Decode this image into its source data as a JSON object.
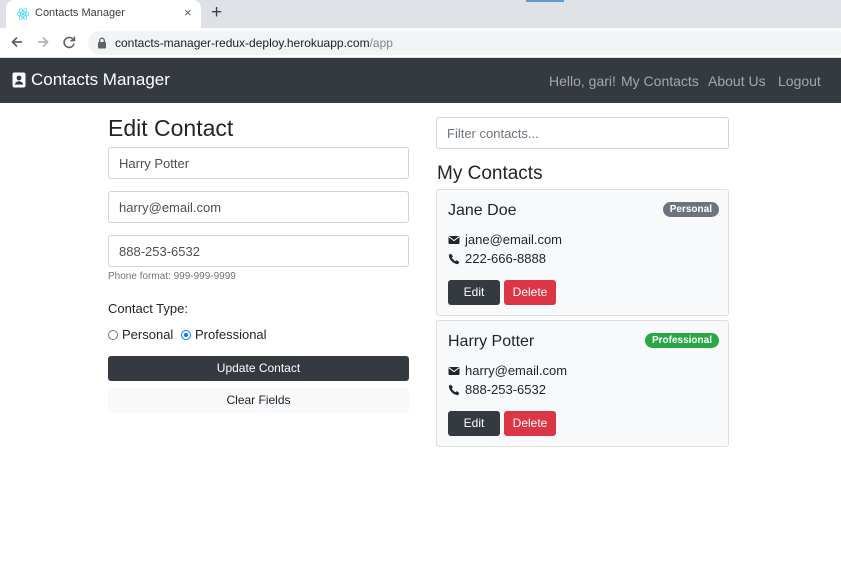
{
  "browser": {
    "tab_title": "Contacts Manager",
    "tab_close": "×",
    "new_tab": "+",
    "url_host": "contacts-manager-redux-deploy.herokuapp.com",
    "url_path": "/app",
    "icons": [
      "react-favicon-icon",
      "back-arrow-icon",
      "forward-arrow-icon",
      "reload-icon",
      "lock-icon"
    ]
  },
  "navbar": {
    "brand": "Contacts Manager",
    "brand_icon": "address-card-icon",
    "greeting": "Hello, gari!",
    "links": [
      "My Contacts",
      "About Us",
      "Logout"
    ],
    "color": "#343a40"
  },
  "form": {
    "title": "Edit Contact",
    "name_value": "Harry Potter",
    "email_value": "harry@email.com",
    "phone_value": "888-253-6532",
    "phone_help": "Phone format: 999-999-9999",
    "type_label": "Contact Type:",
    "type_options": [
      "Personal",
      "Professional"
    ],
    "type_selected": "Professional",
    "update_button": "Update Contact",
    "clear_button": "Clear Fields"
  },
  "contacts": {
    "filter_placeholder": "Filter contacts...",
    "title": "My Contacts",
    "items": [
      {
        "name": "Jane Doe",
        "type": "Personal",
        "email": "jane@email.com",
        "phone": "222-666-8888",
        "badge_color": "#6c757d"
      },
      {
        "name": "Harry Potter",
        "type": "Professional",
        "email": "harry@email.com",
        "phone": "888-253-6532",
        "badge_color": "#28a745"
      }
    ],
    "edit_label": "Edit",
    "delete_label": "Delete",
    "delete_color": "#dc3545"
  }
}
